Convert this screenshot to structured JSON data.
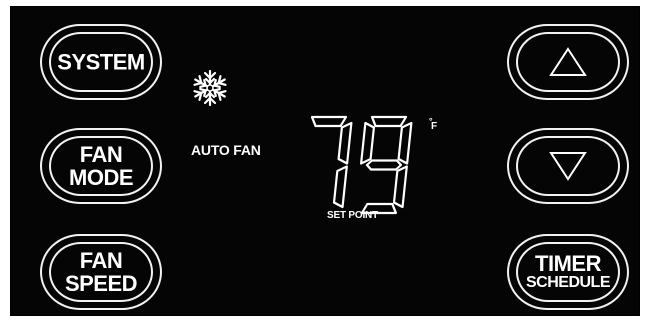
{
  "buttons": {
    "system": [
      "SYSTEM"
    ],
    "fan_mode": [
      "FAN",
      "MODE"
    ],
    "fan_speed": [
      "FAN",
      "SPEED"
    ],
    "timer_schedule": [
      "TIMER",
      "SCHEDULE"
    ]
  },
  "icons": {
    "up": "triangle-up-icon",
    "down": "triangle-down-icon",
    "mode": "snowflake-icon"
  },
  "display": {
    "fan_status": "AUTO FAN",
    "set_point_value": "79",
    "set_point_label": "SET POINT",
    "unit_degree": "°",
    "unit_letter": "F"
  },
  "colors": {
    "panel": "#050505",
    "foreground": "#ffffff"
  }
}
